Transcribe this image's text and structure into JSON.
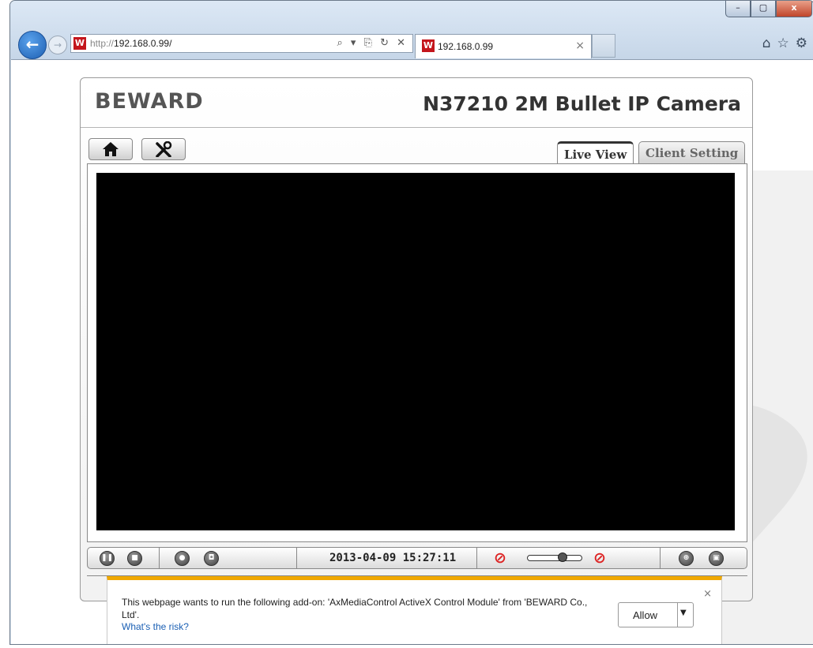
{
  "browser": {
    "address": {
      "url_prefix": "http://",
      "url_host": "192.168.0.99/",
      "tools": "⌕ ▾ ⎘ ↻ ✕"
    },
    "tab": {
      "title": "192.168.0.99",
      "close": "×"
    },
    "window_controls": {
      "minimize": "–",
      "maximize": "▢",
      "close": "x"
    },
    "toolbar_icons": {
      "home": "home-icon",
      "favorites": "star-icon",
      "tools": "gear-icon"
    }
  },
  "camera_page": {
    "brand": "BEWARD",
    "title": "N37210 2M Bullet IP Camera",
    "nav": {
      "home_icon": "home-icon",
      "settings_icon": "tools-icon"
    },
    "tabs": [
      {
        "label": "Live View",
        "active": true
      },
      {
        "label": "Client Setting",
        "active": false
      }
    ],
    "controls": {
      "datetime": "2013-04-09 15:27:11",
      "volume_level": 0.65,
      "icons": [
        "pause-icon",
        "stop-icon",
        "record-icon",
        "snapshot-icon",
        "mute-speaker-icon",
        "volume-slider",
        "mute-mic-icon",
        "zoom-icon",
        "fullscreen-icon"
      ]
    }
  },
  "notification": {
    "message": "This webpage wants to run the following add-on: 'AxMediaControl ActiveX Control Module' from 'BEWARD Co., Ltd'.",
    "link": "What's the risk?",
    "allow_label": "Allow",
    "close": "×",
    "accent_color": "#f0a800"
  }
}
